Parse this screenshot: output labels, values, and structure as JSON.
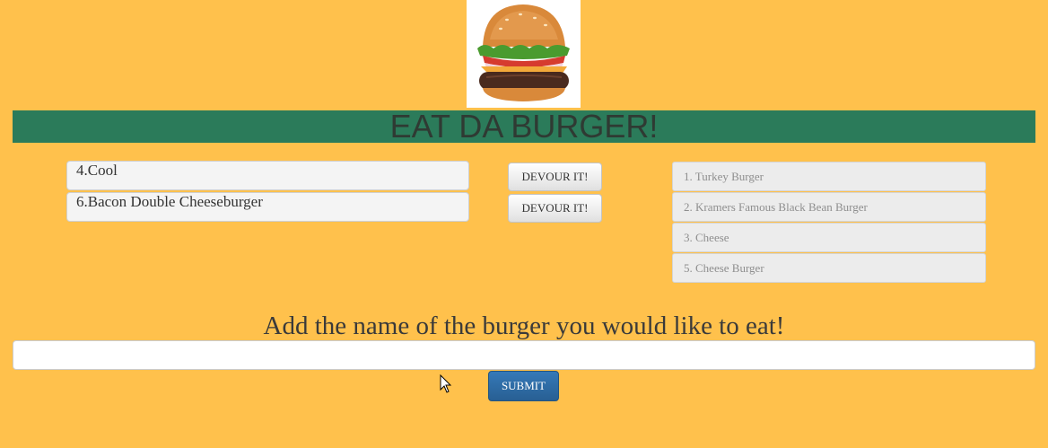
{
  "header": {
    "title": "EAT DA BURGER!",
    "logo_icon": "burger-icon"
  },
  "uneaten": [
    {
      "label": "4.Cool",
      "button_label": "DEVOUR IT!"
    },
    {
      "label": "6.Bacon Double Cheeseburger",
      "button_label": "DEVOUR IT!"
    }
  ],
  "devoured": [
    {
      "label": "1. Turkey Burger"
    },
    {
      "label": "2. Kramers Famous Black Bean Burger"
    },
    {
      "label": "3. Cheese"
    },
    {
      "label": "5. Cheese Burger"
    }
  ],
  "form": {
    "prompt": "Add the name of the burger you would like to eat!",
    "input_value": "",
    "submit_label": "SUBMIT"
  },
  "colors": {
    "background": "#ffc14c",
    "banner": "#2b7b5a",
    "submit": "#2e6da4"
  }
}
